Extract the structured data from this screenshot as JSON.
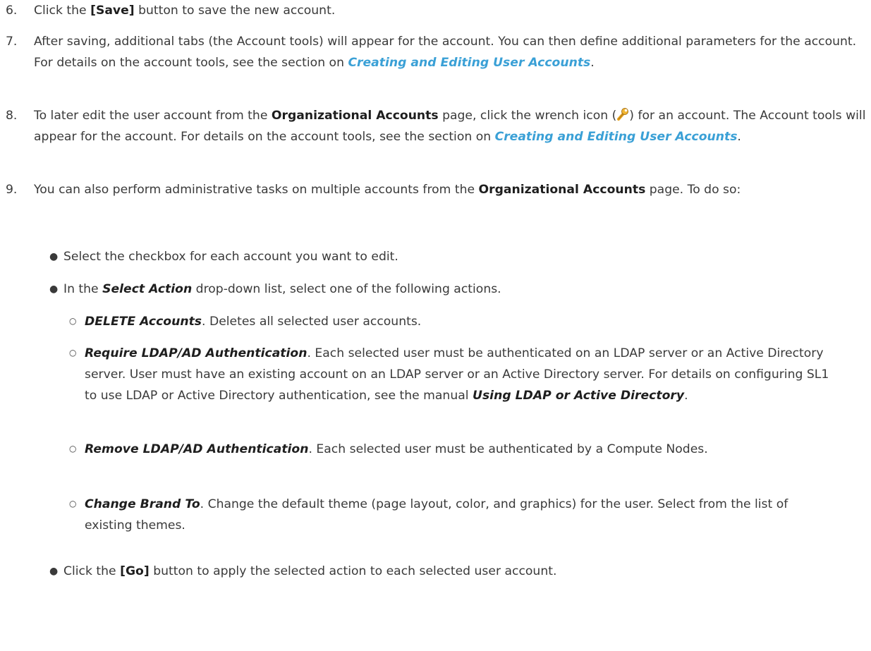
{
  "steps": [
    {
      "number": "6.",
      "pre": "Click the ",
      "button": "[Save]",
      "post": " button to save the new account."
    },
    {
      "number": "7.",
      "text": "After saving, additional tabs (the Account tools) will appear for the account. You can then define additional parameters for the account. For details on the account tools, see the section on ",
      "link": "Creating and Editing User Accounts",
      "post": "."
    },
    {
      "number": "8.",
      "pre": "To later edit the user account from the ",
      "page": "Organizational Accounts",
      "mid": " page, click the wrench icon (",
      "icon": "wrench-icon",
      "mid2": ") for an account. The Account tools will appear for the account. For details on the account tools, see the section on ",
      "link": "Creating and Editing User Accounts",
      "post": "."
    },
    {
      "number": "9.",
      "pre": "You can also perform administrative tasks on multiple accounts from the ",
      "page": "Organizational Accounts",
      "post": " page. To do so:"
    }
  ],
  "bullets": {
    "b1": "Select the checkbox for each account you want to edit.",
    "b2_pre": "In the ",
    "b2_em": "Select Action",
    "b2_post": " drop-down list, select one of the following actions.",
    "b3_pre": "Click the ",
    "b3_button": "[Go]",
    "b3_post": " button to apply the selected action to each selected user account."
  },
  "actions": [
    {
      "name": "DELETE Accounts",
      "desc": ". Deletes all selected user accounts."
    },
    {
      "name": "Require LDAP/AD Authentication",
      "desc": ". Each selected user must be authenticated on an LDAP server or an Active Directory server. User must have an existing account on an LDAP server or an Active Directory server. For details on configuring SL1 to use LDAP or Active Directory authentication, see the manual ",
      "manual": "Using LDAP or Active Directory",
      "tail": "."
    },
    {
      "name": "Remove LDAP/AD Authentication",
      "desc": ". Each selected user must be authenticated by a Compute Nodes."
    },
    {
      "name": "Change Brand To",
      "desc": ". Change the default theme (page layout, color, and graphics) for the user. Select from the list of existing themes."
    }
  ],
  "colors": {
    "text": "#3a3a3a",
    "link": "#3aa0d6",
    "icon_wrench": "#e8a31c"
  }
}
